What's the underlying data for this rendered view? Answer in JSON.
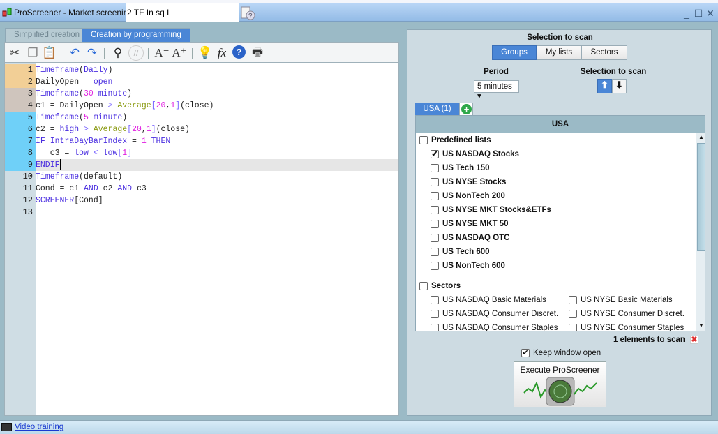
{
  "window": {
    "title": "ProScreener - Market screening",
    "screener_name": "2 TF In sq L"
  },
  "tabs": [
    {
      "label": "Simplified creation"
    },
    {
      "label": "Creation by programming",
      "active": true
    }
  ],
  "toolbar": [
    "cut-icon",
    "copy-icon",
    "paste-icon",
    "undo-icon",
    "redo-icon",
    "search-icon",
    "comment-icon",
    "decrease-font-icon",
    "increase-font-icon",
    "lightbulb-icon",
    "function-icon",
    "help-icon",
    "print-icon"
  ],
  "editor": {
    "line_numbers": [
      "1",
      "2",
      "3",
      "4",
      "5",
      "6",
      "7",
      "8",
      "9",
      "10",
      "11",
      "12",
      "13"
    ],
    "gutter_colors": [
      "#f2cf96",
      "#f2cf96",
      "#cfc5bd",
      "#cfc5bd",
      "#6fd0f8",
      "#6fd0f8",
      "#6fd0f8",
      "#6fd0f8",
      "#6fd0f8",
      "#cfdde4",
      "#cfdde4",
      "#cfdde4",
      "#cfdde4"
    ],
    "current_line": 9,
    "lines": [
      [
        [
          "Timeframe",
          "kw"
        ],
        [
          "(",
          "pl"
        ],
        [
          "Daily",
          "kw"
        ],
        [
          ")",
          "pl"
        ]
      ],
      [
        [
          "DailyOpen = ",
          "pl"
        ],
        [
          "open",
          "var"
        ]
      ],
      [
        [
          "Timeframe",
          "kw"
        ],
        [
          "(",
          "pl"
        ],
        [
          "30",
          "num"
        ],
        [
          " minute",
          "kw"
        ],
        [
          ")",
          "pl"
        ]
      ],
      [
        [
          "c1 = DailyOpen ",
          "pl"
        ],
        [
          ">",
          "op"
        ],
        [
          " ",
          "pl"
        ],
        [
          "Average",
          "fn"
        ],
        [
          "[",
          "op"
        ],
        [
          "20",
          "num"
        ],
        [
          ",",
          "pl"
        ],
        [
          "1",
          "num"
        ],
        [
          "]",
          "op"
        ],
        [
          "(close)",
          "pl"
        ]
      ],
      [
        [
          "Timeframe",
          "kw"
        ],
        [
          "(",
          "pl"
        ],
        [
          "5",
          "num"
        ],
        [
          " minute",
          "kw"
        ],
        [
          ")",
          "pl"
        ]
      ],
      [
        [
          "c2 = ",
          "pl"
        ],
        [
          "high",
          "var"
        ],
        [
          " ",
          "pl"
        ],
        [
          ">",
          "op"
        ],
        [
          " ",
          "pl"
        ],
        [
          "Average",
          "fn"
        ],
        [
          "[",
          "op"
        ],
        [
          "20",
          "num"
        ],
        [
          ",",
          "pl"
        ],
        [
          "1",
          "num"
        ],
        [
          "]",
          "op"
        ],
        [
          "(close)",
          "pl"
        ]
      ],
      [
        [
          "IF IntraDayBarIndex",
          "kw"
        ],
        [
          " = ",
          "pl"
        ],
        [
          "1",
          "num"
        ],
        [
          " THEN",
          "kw"
        ]
      ],
      [
        [
          "   c3 = ",
          "pl"
        ],
        [
          "low",
          "var"
        ],
        [
          " ",
          "pl"
        ],
        [
          "<",
          "op"
        ],
        [
          " ",
          "pl"
        ],
        [
          "low",
          "var"
        ],
        [
          "[",
          "op"
        ],
        [
          "1",
          "num"
        ],
        [
          "]",
          "op"
        ]
      ],
      [
        [
          "ENDIF",
          "kw"
        ]
      ],
      [
        [
          "Timeframe",
          "kw"
        ],
        [
          "(default)",
          "pl"
        ]
      ],
      [
        [
          "Cond = c1 ",
          "pl"
        ],
        [
          "AND",
          "kw"
        ],
        [
          " c2 ",
          "pl"
        ],
        [
          "AND",
          "kw"
        ],
        [
          " c3",
          "pl"
        ]
      ],
      [
        [
          "SCREENER",
          "kw"
        ],
        [
          "[Cond]",
          "pl"
        ]
      ],
      []
    ]
  },
  "right": {
    "selection_title": "Selection to scan",
    "segments": [
      "Groups",
      "My lists",
      "Sectors"
    ],
    "period_label": "Period",
    "period_value": "5 minutes",
    "sort_label": "Selection to scan",
    "group_tab": "USA (1)",
    "list_header": "USA",
    "predefined_label": "Predefined lists",
    "predefined": [
      {
        "label": "US NASDAQ Stocks",
        "checked": true
      },
      {
        "label": "US Tech 150"
      },
      {
        "label": "US NYSE Stocks"
      },
      {
        "label": "US NonTech 200"
      },
      {
        "label": "US NYSE MKT Stocks&ETFs"
      },
      {
        "label": "US NYSE MKT 50"
      },
      {
        "label": "US NASDAQ OTC"
      },
      {
        "label": "US Tech 600"
      },
      {
        "label": "US NonTech 600"
      }
    ],
    "sectors_label": "Sectors",
    "sectors": [
      "US NASDAQ Basic Materials",
      "US NYSE Basic Materials",
      "US NASDAQ Consumer Discret.",
      "US NYSE Consumer Discret.",
      "US NASDAQ Consumer Staples",
      "US NYSE Consumer Staples"
    ],
    "count_text": "1 elements to scan",
    "keep_open": "Keep window open",
    "execute": "Execute ProScreener"
  },
  "footer": {
    "video": "Video training"
  }
}
